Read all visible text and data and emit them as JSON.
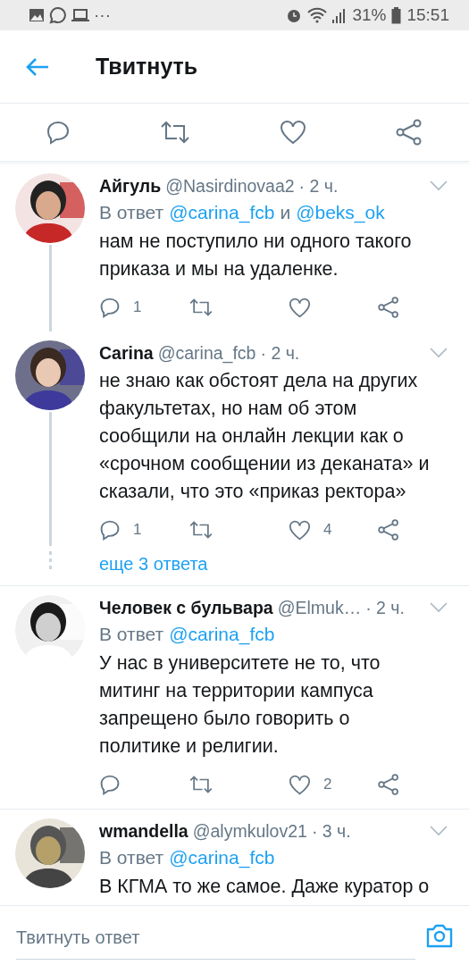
{
  "status_bar": {
    "overflow": "···",
    "battery": "31%",
    "time": "15:51"
  },
  "header": {
    "title": "Твитнуть"
  },
  "tweets": [
    {
      "name": "Айгуль",
      "handle": "@Nasirdinovaa2",
      "time": "· 2 ч.",
      "reply_line": [
        {
          "kind": "plain",
          "text": "В ответ"
        },
        {
          "kind": "link",
          "text": "@carina_fcb"
        },
        {
          "kind": "plain",
          "text": "и"
        },
        {
          "kind": "link",
          "text": "@beks_ok"
        }
      ],
      "body": "нам не поступило ни одного такого приказа и мы на удаленке.",
      "actions": {
        "replies": "1"
      },
      "thread_line": true
    },
    {
      "name": "Carina",
      "handle": "@carina_fcb",
      "time": "· 2 ч.",
      "body": "не знаю как обстоят дела на других факультетах, но нам об этом сообщили на онлайн лекции как о «срочном сообщении из деканата» и сказали, что это «приказ ректора»",
      "actions": {
        "replies": "1",
        "likes": "4"
      },
      "thread_line": true,
      "more": "еще 3 ответа"
    },
    {
      "name": "Человек с бульвара",
      "handle": "@Elmuk…",
      "time": "· 2 ч.",
      "reply_line": [
        {
          "kind": "plain",
          "text": "В ответ"
        },
        {
          "kind": "link",
          "text": "@carina_fcb"
        }
      ],
      "body": "У нас в университете не то, что митинг на территории кампуса запрещено было говорить о политике и религии.",
      "actions": {
        "likes": "2"
      },
      "thread_line": false
    },
    {
      "name": "wmandella",
      "handle": "@alymkulov21",
      "time": "· 3 ч.",
      "reply_line": [
        {
          "kind": "plain",
          "text": "В ответ"
        },
        {
          "kind": "link",
          "text": "@carina_fcb"
        }
      ],
      "body": "В КГМА то же самое. Даже куратор о",
      "thread_line": false
    }
  ],
  "compose": {
    "placeholder": "Твитнуть ответ"
  }
}
